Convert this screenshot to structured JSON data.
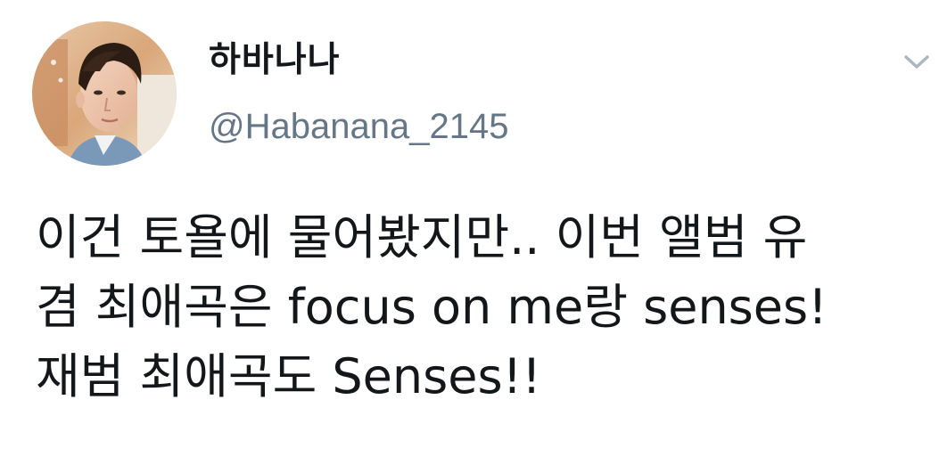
{
  "user": {
    "display_name": "하바나나",
    "handle": "@Habanana_2145",
    "avatar_icon": "profile-avatar"
  },
  "tweet": {
    "lines": [
      "이건 토욜에 물어봤지만.. 이번 앨범 유",
      "겸 최애곡은 focus on me랑 senses!",
      "재범 최애곡도 Senses!!"
    ]
  },
  "menu": {
    "icon": "chevron-down-icon",
    "color": "#aab8c2"
  }
}
